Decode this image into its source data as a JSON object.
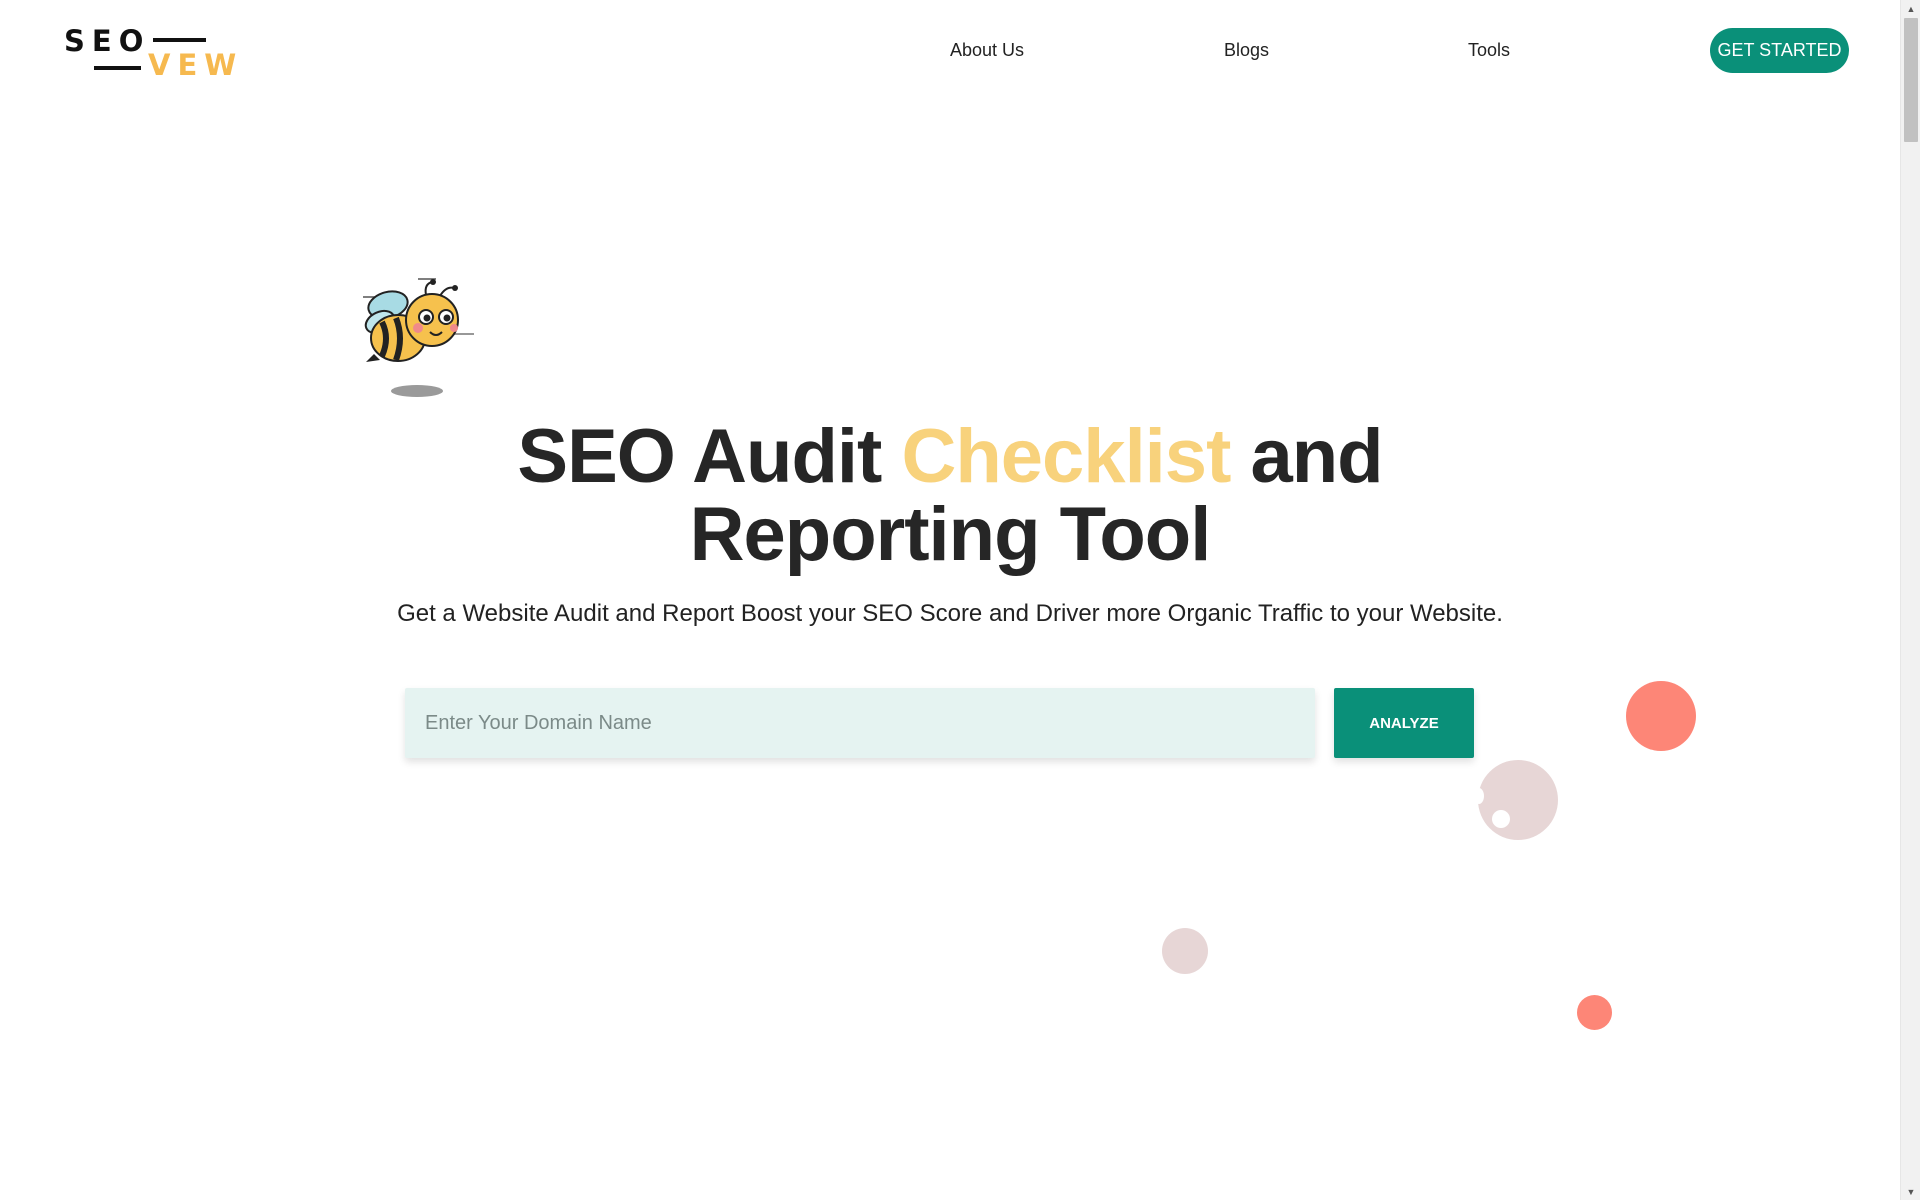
{
  "header": {
    "logo": {
      "line1": "SEO",
      "line2": "VEW"
    },
    "nav": [
      {
        "label": "About Us"
      },
      {
        "label": "Blogs"
      },
      {
        "label": "Tools"
      }
    ],
    "cta_label": "GET STARTED"
  },
  "hero": {
    "title_part1": "SEO Audit ",
    "title_accent": "Checklist",
    "title_part2": " and",
    "title_line2": "Reporting Tool",
    "subtitle": "Get a Website Audit and Report Boost your SEO Score and Driver more Organic Traffic to your Website.",
    "search": {
      "placeholder": "Enter Your Domain Name",
      "value": "",
      "button_label": "ANALYZE"
    },
    "mascot": "bee-mascot-icon"
  },
  "colors": {
    "brand_green": "#0a9079",
    "accent_yellow": "#f8d27c",
    "logo_yellow": "#f6b94f",
    "input_bg": "#e5f3f1",
    "coral": "#fd8677",
    "pink_grey": "#e7d6d6"
  }
}
